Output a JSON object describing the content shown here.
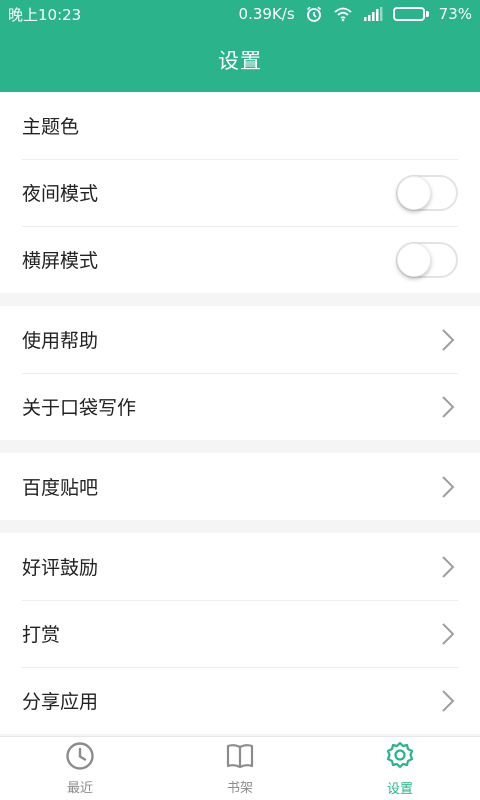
{
  "status_bar": {
    "time": "晚上10:23",
    "net_speed": "0.39K/s",
    "battery_percent": "73%",
    "battery_level": 0.73,
    "icons": [
      "alarm-icon",
      "wifi-icon",
      "signal-icon",
      "battery-icon"
    ]
  },
  "app_bar": {
    "title": "设置"
  },
  "settings": {
    "group1": [
      {
        "label": "主题色"
      },
      {
        "label": "夜间模式",
        "toggle": false
      },
      {
        "label": "横屏模式",
        "toggle": false
      }
    ],
    "group2": [
      {
        "label": "使用帮助"
      },
      {
        "label": "关于口袋写作"
      }
    ],
    "group3": [
      {
        "label": "百度贴吧"
      }
    ],
    "group4": [
      {
        "label": "好评鼓励"
      },
      {
        "label": "打赏"
      },
      {
        "label": "分享应用"
      }
    ]
  },
  "bottom_nav": {
    "items": [
      {
        "label": "最近",
        "icon": "clock-icon",
        "active": false
      },
      {
        "label": "书架",
        "icon": "book-icon",
        "active": false
      },
      {
        "label": "设置",
        "icon": "gear-icon",
        "active": true
      }
    ]
  },
  "colors": {
    "accent": "#2bb38c",
    "inactive": "#8c8c8c"
  }
}
